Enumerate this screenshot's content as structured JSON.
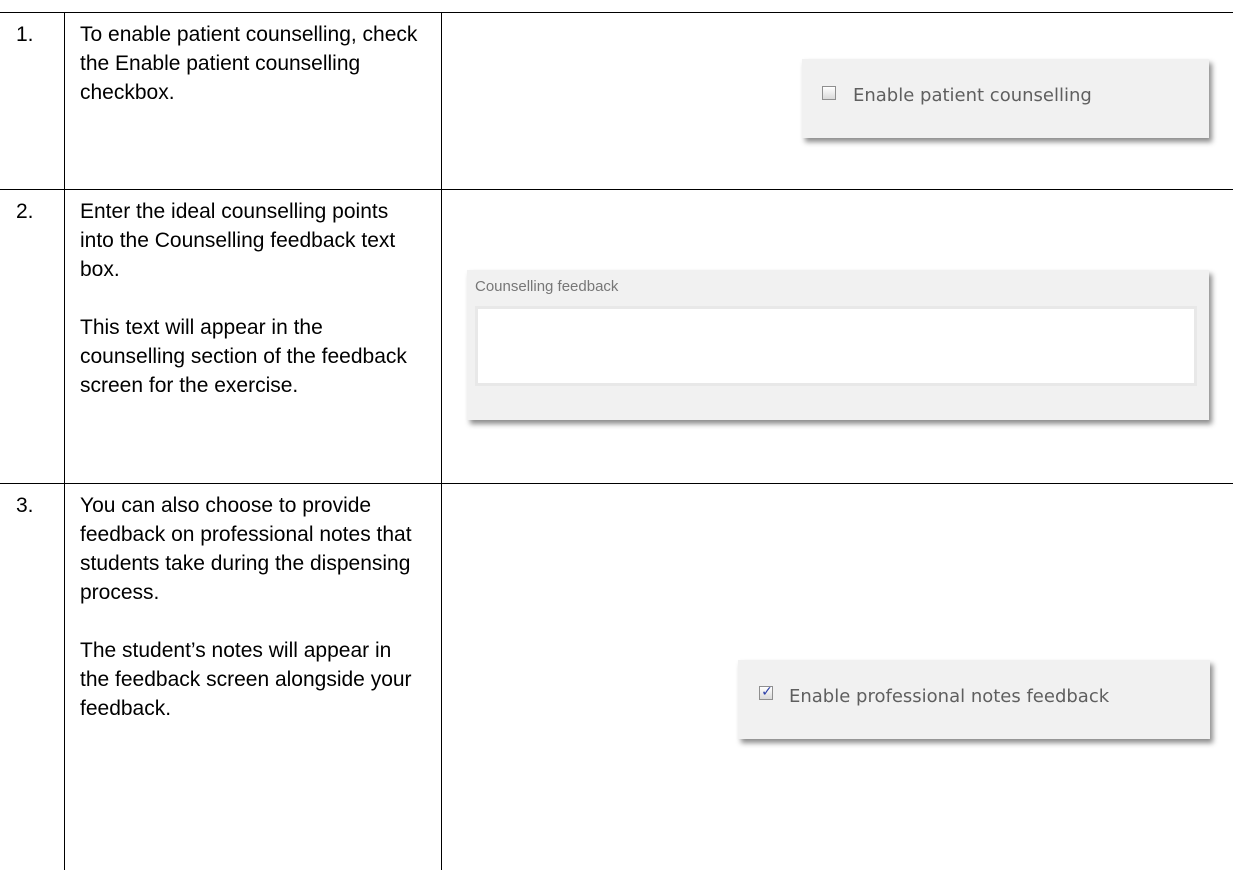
{
  "steps": [
    {
      "number": "1.",
      "paragraphs": [
        "To enable patient counselling, check the Enable patient counselling checkbox."
      ]
    },
    {
      "number": "2.",
      "paragraphs": [
        "Enter the ideal counselling points into the Counselling feedback text box.",
        "This text will appear in the counselling section of the feedback screen for the exercise."
      ]
    },
    {
      "number": "3.",
      "paragraphs": [
        "You can also choose to provide feedback on professional notes that students take during the dispensing process.",
        "The student’s notes will appear in the feedback screen alongside your feedback."
      ]
    }
  ],
  "ui": {
    "enable_counselling": {
      "label": "Enable patient counselling",
      "checked": false
    },
    "counselling_feedback": {
      "label": "Counselling feedback",
      "value": ""
    },
    "enable_notes_feedback": {
      "label": "Enable professional notes feedback",
      "checked": true
    }
  },
  "colors": {
    "panel_bg": "#f1f1f1",
    "label_text": "#5f5f5f",
    "check_tick": "#2b3fa8"
  }
}
